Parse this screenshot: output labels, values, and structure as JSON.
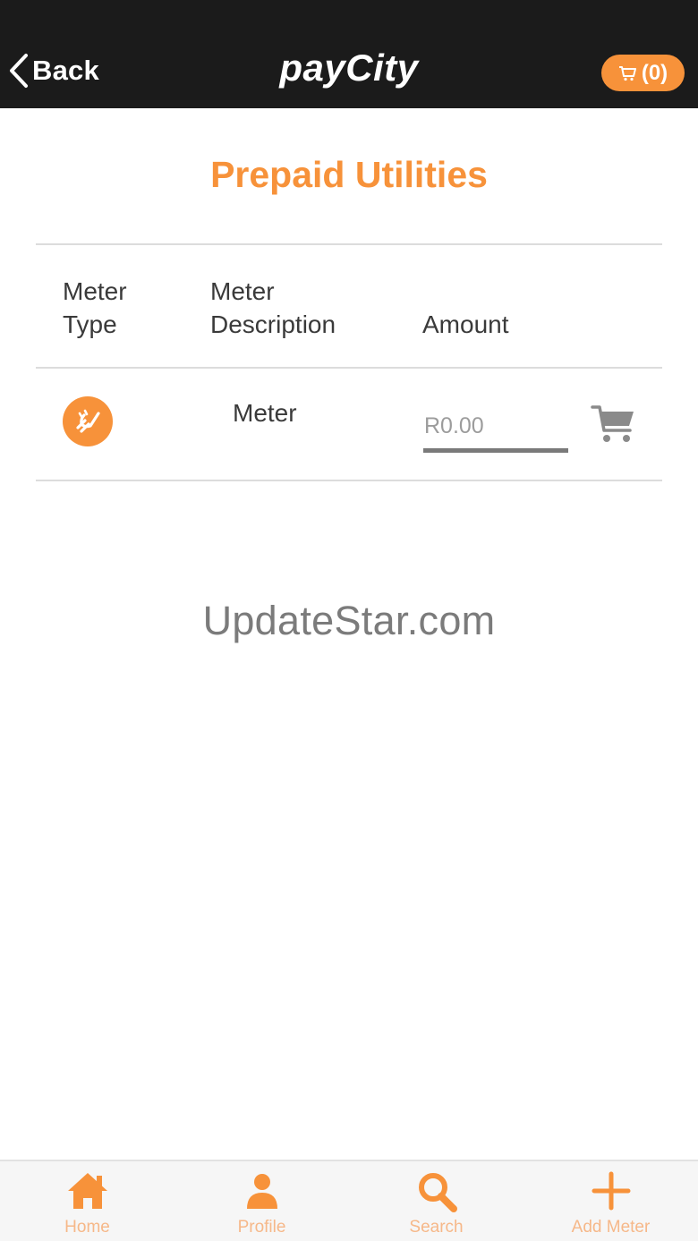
{
  "header": {
    "back_label": "Back",
    "brand": "payCity",
    "cart_label": "(0)",
    "back_icon": "chevron-left-icon",
    "cart_icon": "shopping-cart-icon"
  },
  "page": {
    "title": "Prepaid Utilities"
  },
  "table": {
    "headers": {
      "meter_type_line1": "Meter",
      "meter_type_line2": "Type",
      "meter_desc_line1": "Meter",
      "meter_desc_line2": "Description",
      "amount": "Amount"
    },
    "rows": [
      {
        "type_icon": "electricity-plug-icon",
        "description": "Meter",
        "amount_placeholder": "R0.00",
        "amount_value": "",
        "cart_icon": "shopping-cart-icon"
      }
    ]
  },
  "watermark": "UpdateStar.com",
  "tabbar": {
    "items": [
      {
        "label": "Home",
        "icon": "home-icon"
      },
      {
        "label": "Profile",
        "icon": "profile-icon"
      },
      {
        "label": "Search",
        "icon": "search-icon"
      },
      {
        "label": "Add Meter",
        "icon": "plus-icon"
      }
    ]
  },
  "colors": {
    "accent": "#f7923a",
    "header_bg": "#1b1b1b",
    "tab_label": "#f6b889"
  }
}
